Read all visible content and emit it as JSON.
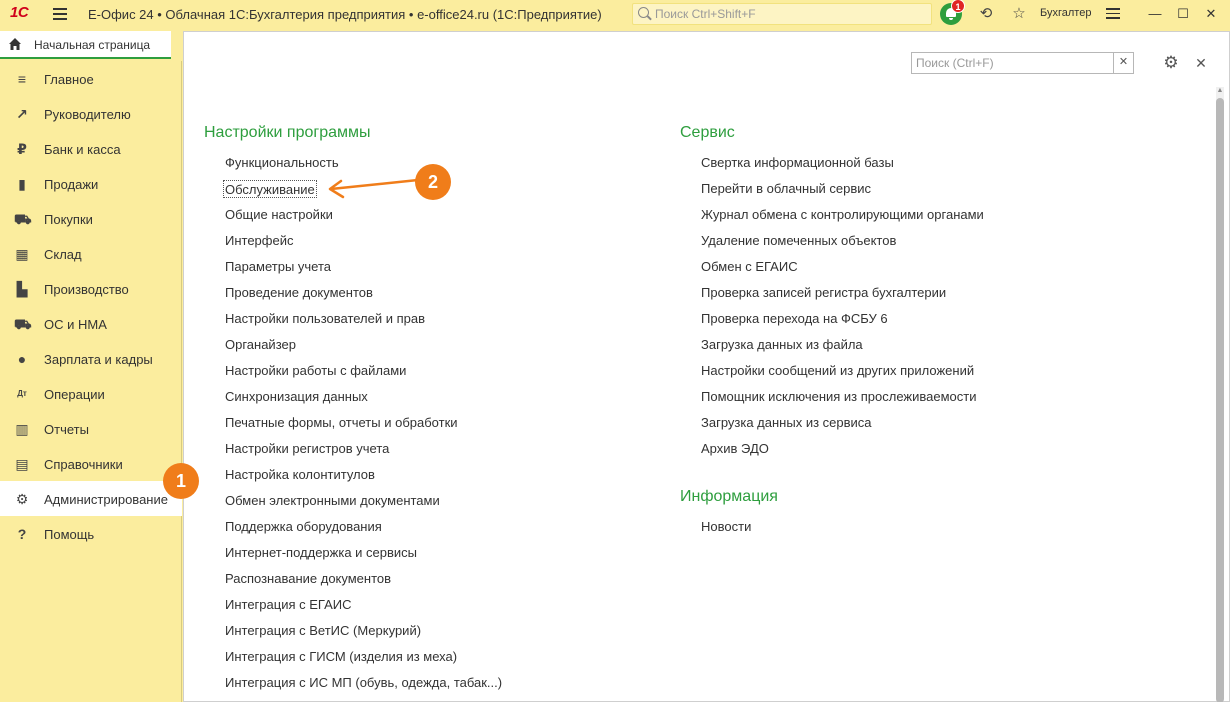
{
  "titlebar": {
    "logo": "1С",
    "title": "Е-Офис 24 • Облачная 1С:Бухгалтерия предприятия • e-office24.ru  (1С:Предприятие)",
    "search_placeholder": "Поиск Ctrl+Shift+F",
    "notification_count": "1",
    "user": "Бухгалтер",
    "accent_color": "#2e9e3e",
    "background_color": "#fbed9e"
  },
  "start_tab": {
    "label": "Начальная страница"
  },
  "sidebar": {
    "items": [
      {
        "label": "Главное",
        "icon": "menu-icon",
        "glyph": "≡"
      },
      {
        "label": "Руководителю",
        "icon": "trend-icon",
        "glyph": "↗"
      },
      {
        "label": "Банк и касса",
        "icon": "ruble-icon",
        "glyph": "₽"
      },
      {
        "label": "Продажи",
        "icon": "bag-icon",
        "glyph": "▮"
      },
      {
        "label": "Покупки",
        "icon": "cart-icon",
        "glyph": "⛟"
      },
      {
        "label": "Склад",
        "icon": "warehouse-icon",
        "glyph": "▦"
      },
      {
        "label": "Производство",
        "icon": "factory-icon",
        "glyph": "▙"
      },
      {
        "label": "ОС и НМА",
        "icon": "truck-icon",
        "glyph": "⛟"
      },
      {
        "label": "Зарплата и кадры",
        "icon": "person-icon",
        "glyph": "●"
      },
      {
        "label": "Операции",
        "icon": "dt-kt-icon",
        "glyph": "Дт"
      },
      {
        "label": "Отчеты",
        "icon": "bar-chart-icon",
        "glyph": "▥"
      },
      {
        "label": "Справочники",
        "icon": "book-icon",
        "glyph": "▤"
      },
      {
        "label": "Администрирование",
        "icon": "gear-icon",
        "glyph": "⚙"
      },
      {
        "label": "Помощь",
        "icon": "question-icon",
        "glyph": "?"
      }
    ],
    "active_index": 12
  },
  "main": {
    "search_placeholder": "Поиск (Ctrl+F)",
    "settings_title": "Настройки программы",
    "settings_links": [
      "Функциональность",
      "Обслуживание",
      "Общие настройки",
      "Интерфейс",
      "Параметры учета",
      "Проведение документов",
      "Настройки пользователей и прав",
      "Органайзер",
      "Настройки работы с файлами",
      "Синхронизация данных",
      "Печатные формы, отчеты и обработки",
      "Настройки регистров учета",
      "Настройка колонтитулов",
      "Обмен электронными документами",
      "Поддержка оборудования",
      "Интернет-поддержка и сервисы",
      "Распознавание документов",
      "Интеграция с ЕГАИС",
      "Интеграция с ВетИС (Меркурий)",
      "Интеграция с ГИСМ (изделия из меха)",
      "Интеграция с ИС МП (обувь, одежда, табак...)"
    ],
    "service_title": "Сервис",
    "service_links": [
      "Свертка информационной базы",
      "Перейти в облачный сервис",
      "Журнал обмена с контролирующими органами",
      "Удаление помеченных объектов",
      "Обмен с ЕГАИС",
      "Проверка записей регистра бухгалтерии",
      "Проверка перехода на ФСБУ 6",
      "Загрузка данных из файла",
      "Настройки сообщений из других приложений",
      "Помощник исключения из прослеживаемости",
      "Загрузка данных из сервиса",
      "Архив ЭДО"
    ],
    "info_title": "Информация",
    "info_links": [
      "Новости"
    ]
  },
  "callouts": {
    "first": "1",
    "second": "2",
    "color": "#f07d1a"
  }
}
